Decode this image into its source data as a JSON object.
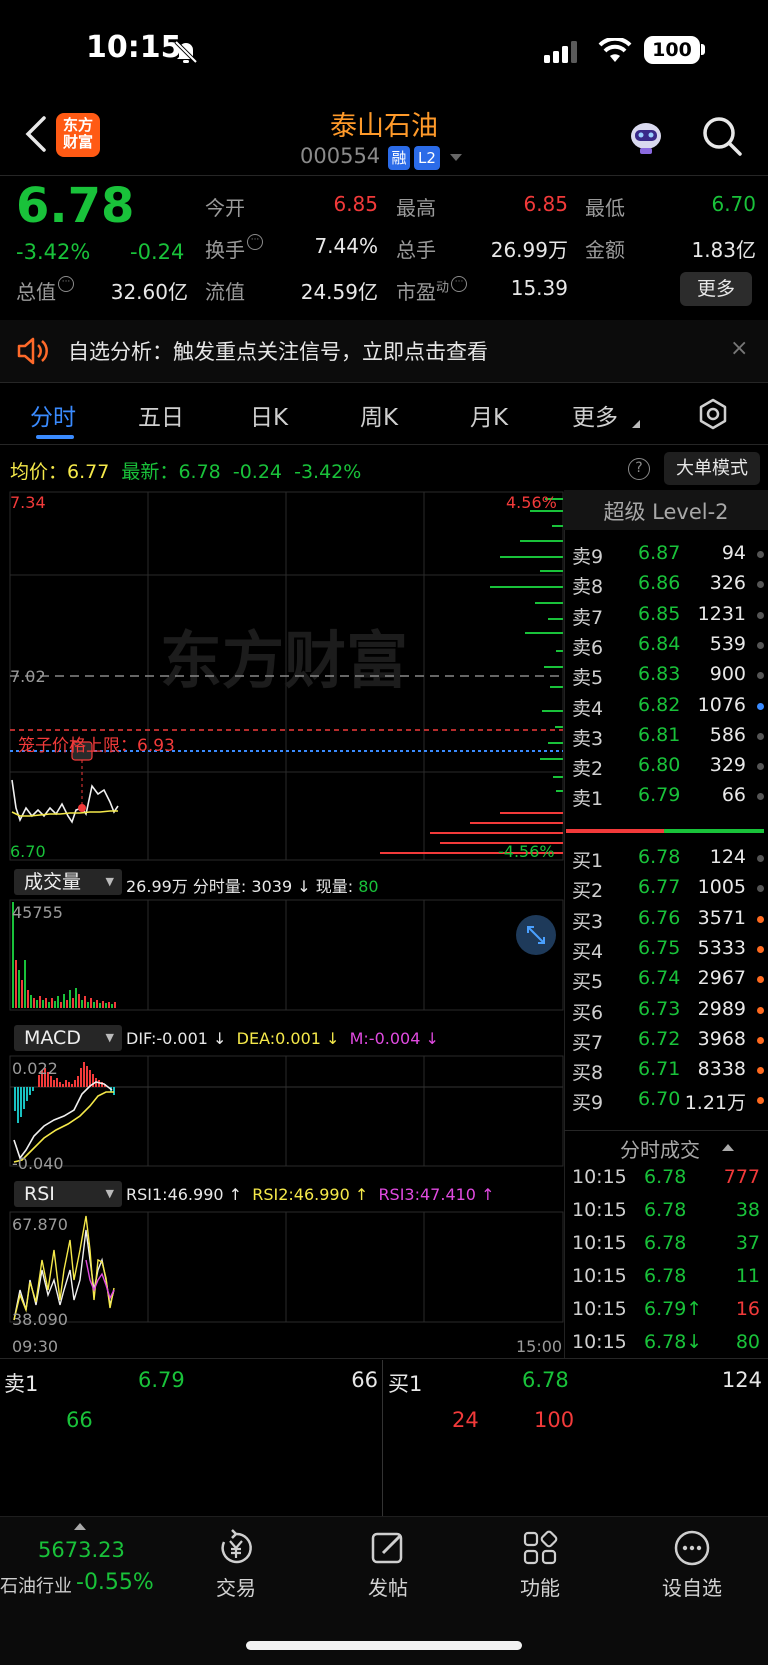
{
  "status": {
    "time": "10:15",
    "battery": "100"
  },
  "header": {
    "logo_line1": "东方",
    "logo_line2": "财富",
    "stock_name": "泰山石油",
    "stock_code": "000554",
    "badge_margin": "融",
    "badge_level": "L2"
  },
  "quote": {
    "price": "6.78",
    "pct_change": "-3.42%",
    "abs_change": "-0.24",
    "open_label": "今开",
    "open": "6.85",
    "high_label": "最高",
    "high": "6.85",
    "low_label": "最低",
    "low": "6.70",
    "turnover_label": "换手",
    "turnover": "7.44%",
    "volume_label": "总手",
    "volume": "26.99万",
    "amount_label": "金额",
    "amount": "1.83亿",
    "mktcap_label": "总值",
    "mktcap": "32.60亿",
    "float_label": "流值",
    "float_cap": "24.59亿",
    "pe_label": "市盈",
    "pe_sup": "动",
    "pe": "15.39",
    "more_label": "更多"
  },
  "notice": {
    "text": "自选分析：触发重点关注信号，立即点击查看",
    "close": "×"
  },
  "tabs": [
    "分时",
    "五日",
    "日K",
    "周K",
    "月K",
    "更多"
  ],
  "chart_head": {
    "avg_label": "均价：",
    "avg": "6.77",
    "latest_label": "最新：",
    "latest": "6.78",
    "chg": "-0.24",
    "pct": "-3.42%",
    "help": "?",
    "big_order_label": "大单模式"
  },
  "chart_labels": {
    "price_top": "7.34",
    "price_pct_top": "4.56%",
    "price_mid": "7.02",
    "price_bottom": "6.70",
    "price_pct_bottom": "-4.56%",
    "limit_line": "笼子价格上限：6.93",
    "vol_max": "45755",
    "macd_top": "0.022",
    "macd_bottom": "-0.040",
    "rsi_top": "67.870",
    "rsi_bottom": "38.090",
    "time_start": "09:30",
    "time_end": "15:00"
  },
  "volume_panel": {
    "select": "成交量",
    "total": "26.99万",
    "minute_label": "分时量:",
    "minute_vol": "3039",
    "current_label": "现量:",
    "current_vol": "80"
  },
  "macd_panel": {
    "select": "MACD",
    "dif": "DIF:-0.001 ↓",
    "dea": "DEA:0.001 ↓",
    "m": "M:-0.004 ↓"
  },
  "rsi_panel": {
    "select": "RSI",
    "rsi1": "RSI1:46.990 ↑",
    "rsi2": "RSI2:46.990 ↑",
    "rsi3": "RSI3:47.410 ↑"
  },
  "order_book": {
    "title": "超级 Level-2",
    "asks": [
      {
        "label": "卖9",
        "price": "6.87",
        "vol": "94",
        "dot": "gray"
      },
      {
        "label": "卖8",
        "price": "6.86",
        "vol": "326",
        "dot": "gray"
      },
      {
        "label": "卖7",
        "price": "6.85",
        "vol": "1231",
        "dot": "gray"
      },
      {
        "label": "卖6",
        "price": "6.84",
        "vol": "539",
        "dot": "gray"
      },
      {
        "label": "卖5",
        "price": "6.83",
        "vol": "900",
        "dot": "gray"
      },
      {
        "label": "卖4",
        "price": "6.82",
        "vol": "1076",
        "dot": "blue"
      },
      {
        "label": "卖3",
        "price": "6.81",
        "vol": "586",
        "dot": "gray"
      },
      {
        "label": "卖2",
        "price": "6.80",
        "vol": "329",
        "dot": "gray"
      },
      {
        "label": "卖1",
        "price": "6.79",
        "vol": "66",
        "dot": "gray"
      }
    ],
    "bids": [
      {
        "label": "买1",
        "price": "6.78",
        "vol": "124",
        "dot": "gray"
      },
      {
        "label": "买2",
        "price": "6.77",
        "vol": "1005",
        "dot": "gray"
      },
      {
        "label": "买3",
        "price": "6.76",
        "vol": "3571",
        "dot": "orange"
      },
      {
        "label": "买4",
        "price": "6.75",
        "vol": "5333",
        "dot": "orange"
      },
      {
        "label": "买5",
        "price": "6.74",
        "vol": "2967",
        "dot": "orange"
      },
      {
        "label": "买6",
        "price": "6.73",
        "vol": "2989",
        "dot": "orange"
      },
      {
        "label": "买7",
        "price": "6.72",
        "vol": "3968",
        "dot": "orange"
      },
      {
        "label": "买8",
        "price": "6.71",
        "vol": "8338",
        "dot": "orange"
      },
      {
        "label": "买9",
        "price": "6.70",
        "vol": "1.21万",
        "dot": "orange"
      }
    ]
  },
  "trades": {
    "title": "分时成交",
    "rows": [
      {
        "time": "10:15",
        "price": "6.78",
        "vol": "777",
        "color": "red"
      },
      {
        "time": "10:15",
        "price": "6.78",
        "vol": "38",
        "color": "green"
      },
      {
        "time": "10:15",
        "price": "6.78",
        "vol": "37",
        "color": "green"
      },
      {
        "time": "10:15",
        "price": "6.78",
        "vol": "11",
        "color": "green"
      },
      {
        "time": "10:15",
        "price": "6.79↑",
        "vol": "16",
        "color": "red"
      },
      {
        "time": "10:15",
        "price": "6.78↓",
        "vol": "80",
        "color": "green"
      }
    ]
  },
  "lower_panel": {
    "ask_label": "卖1",
    "ask_price": "6.79",
    "ask_vol": "66",
    "ask_detail": "66",
    "bid_label": "买1",
    "bid_price": "6.78",
    "bid_vol": "124",
    "bid_detail1": "24",
    "bid_detail2": "100"
  },
  "bottom_nav": {
    "index_value": "5673.23",
    "index_name": "石油行业",
    "index_pct": "-0.55%",
    "items": [
      "交易",
      "发帖",
      "功能",
      "设自选"
    ]
  },
  "colors": {
    "up": "#f23a3a",
    "down": "#19c23a",
    "accent": "#3a8bff",
    "brand": "#ff5a14"
  }
}
